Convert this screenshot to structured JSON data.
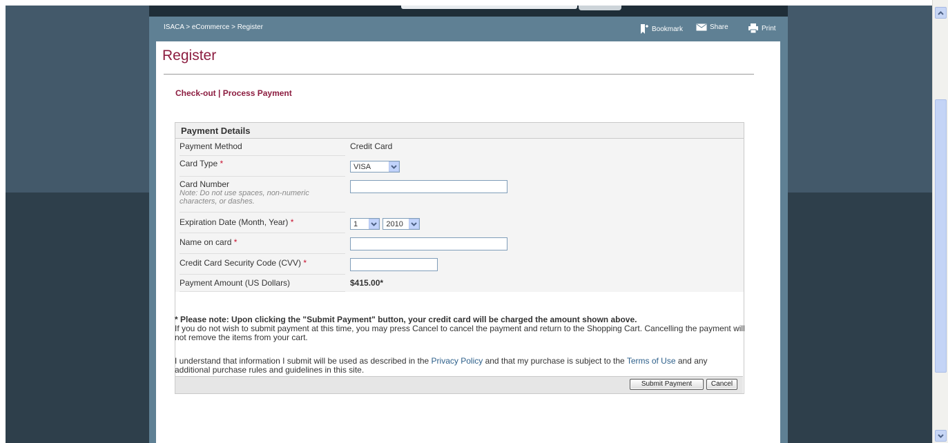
{
  "breadcrumb": "ISACA > eCommerce > Register",
  "tools": {
    "bookmark": "Bookmark",
    "share": "Share",
    "print": "Print"
  },
  "page_title": "Register",
  "steps": "Check-out | Process Payment",
  "panel_title": "Payment Details",
  "fields": {
    "payment_method": {
      "label": "Payment Method",
      "value": "Credit Card"
    },
    "card_type": {
      "label": "Card Type",
      "required": "*",
      "selected": "VISA"
    },
    "card_number": {
      "label": "Card Number",
      "note": "Note: Do not use spaces, non-numeric characters, or dashes.",
      "value": ""
    },
    "expiration": {
      "label": "Expiration Date (Month, Year)",
      "required": "*",
      "month": "1",
      "year": "2010"
    },
    "name_on_card": {
      "label": "Name on card",
      "required": "*",
      "value": ""
    },
    "cvv": {
      "label": "Credit Card Security Code (CVV)",
      "required": "*",
      "value": ""
    },
    "amount": {
      "label": "Payment Amount (US Dollars)",
      "value": "$415.00*"
    }
  },
  "notice": {
    "bold": "* Please note: Upon clicking the \"Submit Payment\" button, your credit card will be charged the amount shown above.",
    "text": "If you do not wish to submit payment at this time, you may press Cancel to cancel the payment and return to the Shopping Cart.  Cancelling the payment will not remove the items from your cart."
  },
  "understand": {
    "part1": "I understand that information I submit will be used as described in the ",
    "privacy_link": "Privacy Policy",
    "part2": " and that my purchase is subject to the ",
    "terms_link": "Terms of Use",
    "part3": " and any additional purchase rules and guidelines in this site."
  },
  "buttons": {
    "submit": "Submit Payment",
    "cancel": "Cancel"
  }
}
